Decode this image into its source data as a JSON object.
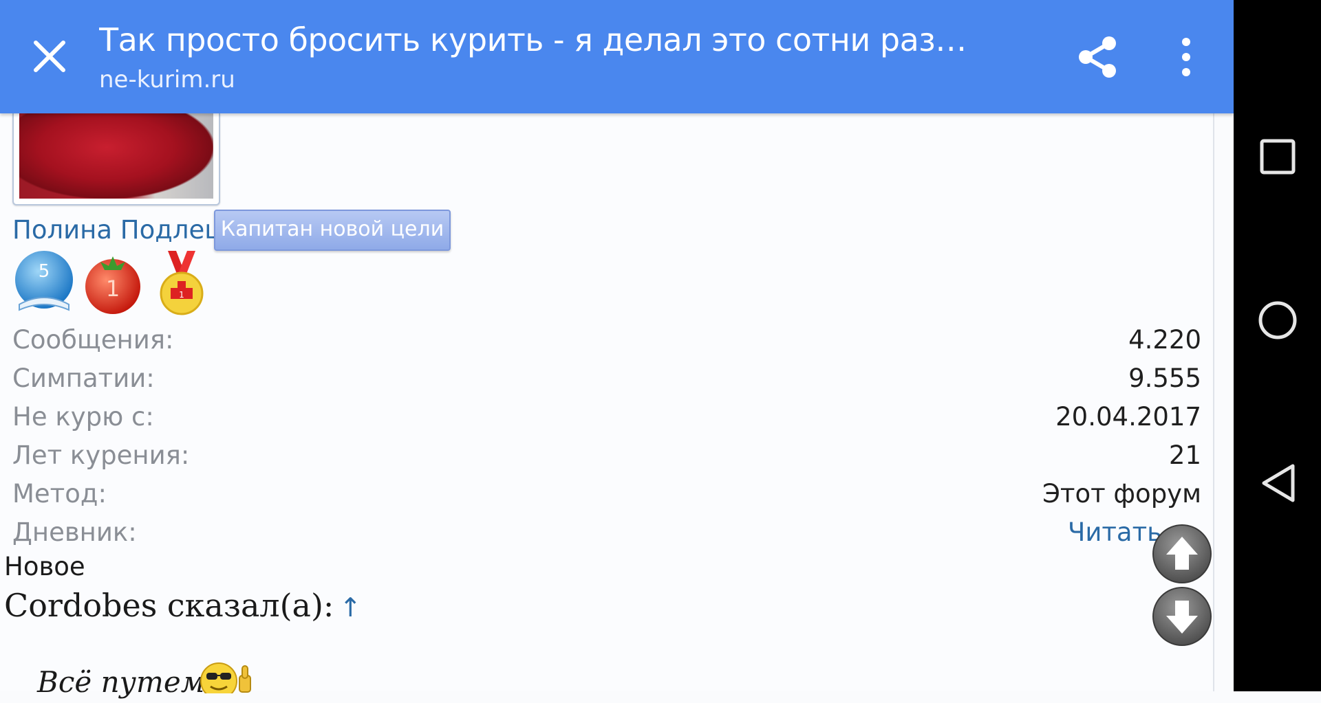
{
  "browser": {
    "title": "Так просто бросить курить - я делал это сотни раз | Ст...",
    "url": "ne-kurim.ru"
  },
  "profile": {
    "username": "Полина Подлец",
    "rank": "Капитан новой цели",
    "trophies": [
      {
        "name": "books-trophy",
        "value": "5"
      },
      {
        "name": "tomato-trophy",
        "value": "1"
      },
      {
        "name": "medal-trophy",
        "value": "1"
      }
    ],
    "stats": [
      {
        "label": "Сообщения:",
        "value": "4.220"
      },
      {
        "label": "Симпатии:",
        "value": "9.555"
      },
      {
        "label": "Не курю с:",
        "value": "20.04.2017"
      },
      {
        "label": "Лет курения:",
        "value": "21"
      },
      {
        "label": "Метод:",
        "value": "Этот форум"
      },
      {
        "label": "Дневник:",
        "value": "Читать »»"
      }
    ]
  },
  "post": {
    "new_label": "Новое",
    "quote_author": "Cordobes сказал(а):",
    "quote_arrow": "↑",
    "quote_text": "Всё путем"
  },
  "colors": {
    "toolbar": "#4a87ee",
    "link": "#2a6aa6",
    "label": "#8a8e95"
  }
}
